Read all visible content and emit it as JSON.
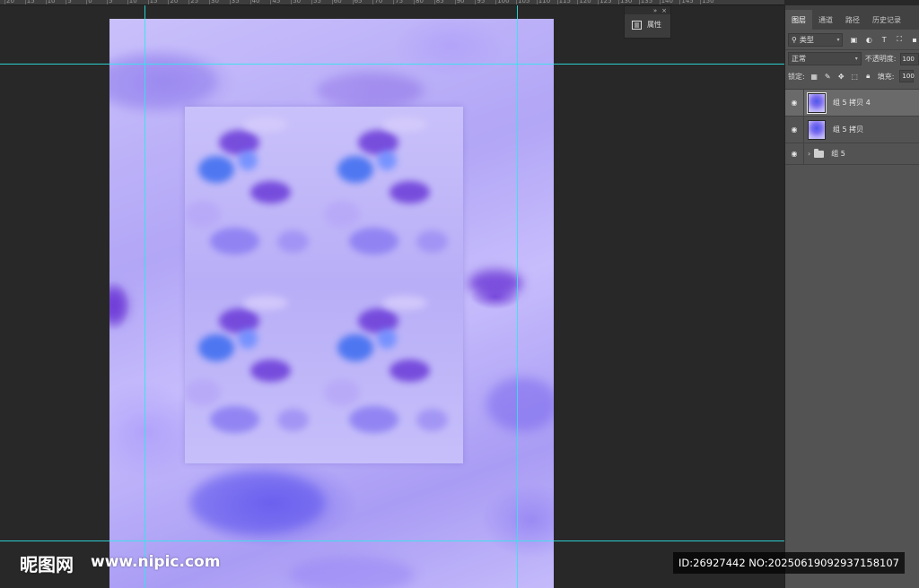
{
  "ruler": {
    "labels": [
      "20",
      "15",
      "10",
      "5",
      "0",
      "5",
      "10",
      "15",
      "20",
      "25",
      "30",
      "35",
      "40",
      "45",
      "50",
      "55",
      "60",
      "65",
      "70",
      "75",
      "80",
      "85",
      "90",
      "95",
      "100",
      "105",
      "110",
      "115",
      "120",
      "125",
      "130",
      "135",
      "140",
      "145",
      "150"
    ]
  },
  "properties_panel": {
    "title": "属性",
    "collapse_glyph": "»",
    "close_glyph": "×"
  },
  "layers_panel": {
    "tabs": [
      {
        "label": "图层",
        "active": true
      },
      {
        "label": "通道",
        "active": false
      },
      {
        "label": "路径",
        "active": false
      },
      {
        "label": "历史记录",
        "active": false
      }
    ],
    "filter_kind": "类型",
    "blend_mode": "正常",
    "opacity_label": "不透明度:",
    "opacity_value": "100",
    "lock_label": "锁定:",
    "fill_label": "填充:",
    "fill_value": "100",
    "layers": [
      {
        "name": "组 5 拷贝 4",
        "type": "layer",
        "visible": true,
        "selected": true
      },
      {
        "name": "组 5 拷贝",
        "type": "layer",
        "visible": true,
        "selected": false
      },
      {
        "name": "组 5",
        "type": "group",
        "visible": true,
        "selected": false
      }
    ]
  },
  "watermark": {
    "site_name": "昵图网",
    "site_url": "www.nipic.com",
    "id_text": "ID:26927442 NO:20250619092937158107"
  },
  "colors": {
    "guide": "#2ee8ea",
    "panel_bg": "#535353",
    "canvas_bg": "#282828",
    "accent_lilac": "#b2a6f6",
    "flower_blue": "#3b6cf0",
    "flower_purple": "#6a3ad8"
  }
}
